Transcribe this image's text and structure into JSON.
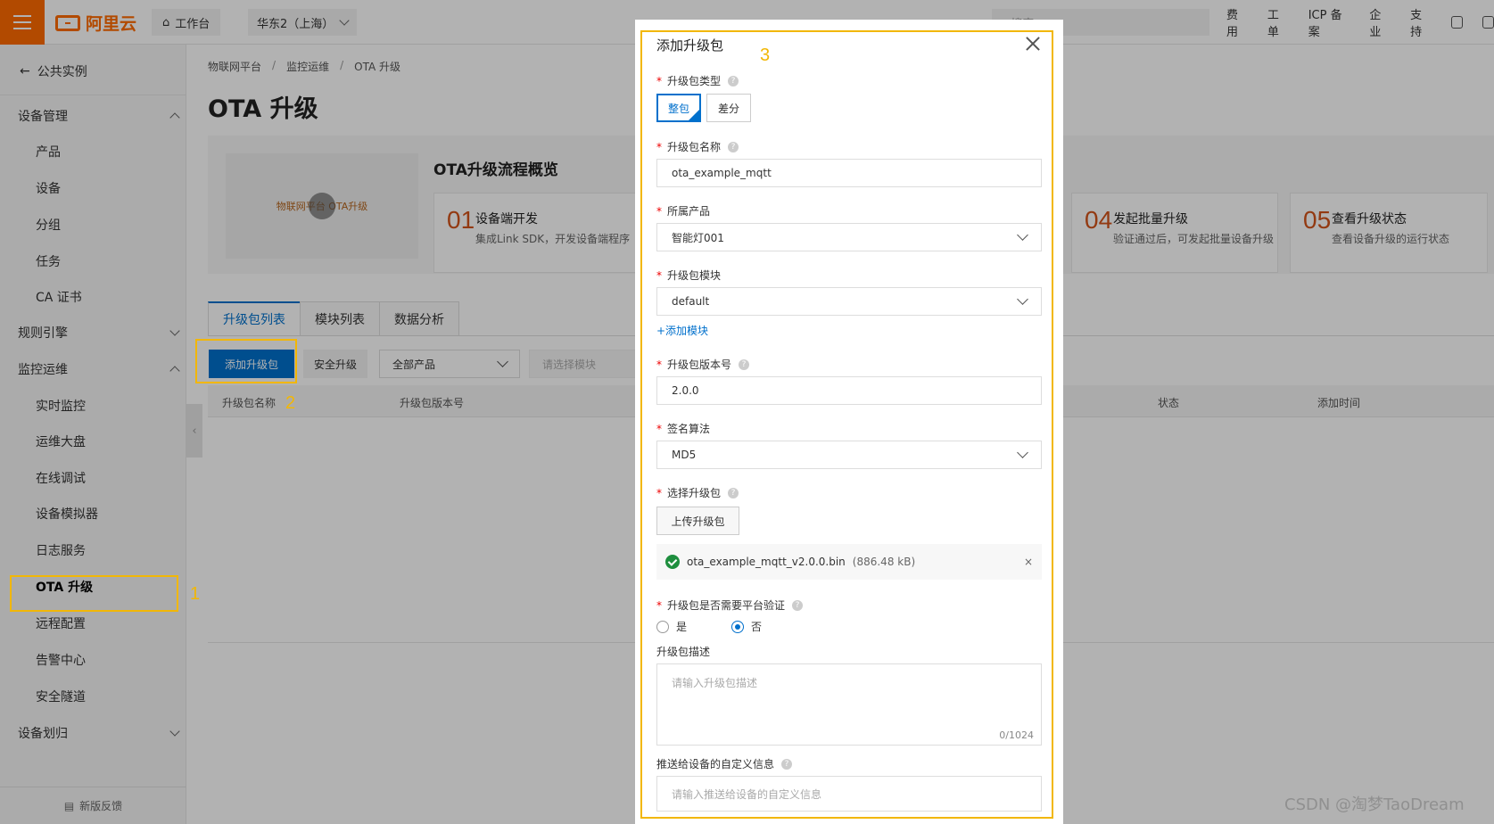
{
  "topbar": {
    "logo_text": "阿里云",
    "workbench": "工作台",
    "region": "华东2（上海）",
    "search_placeholder": "搜索",
    "links": [
      "费用",
      "工单",
      "ICP 备案",
      "企业",
      "支持"
    ]
  },
  "sidebar": {
    "back_label": "公共实例",
    "groups": {
      "device_mgmt": "设备管理",
      "rules": "规则引擎",
      "monitor": "监控运维",
      "assign": "设备划归"
    },
    "items": {
      "product": "产品",
      "device": "设备",
      "group": "分组",
      "task": "任务",
      "ca": "CA 证书",
      "realtime": "实时监控",
      "dashboard": "运维大盘",
      "debug": "在线调试",
      "simulator": "设备模拟器",
      "log": "日志服务",
      "ota": "OTA 升级",
      "remote": "远程配置",
      "alarm": "告警中心",
      "tunnel": "安全隧道"
    },
    "feedback": "新版反馈"
  },
  "main": {
    "breadcrumb": [
      "物联网平台",
      "监控运维",
      "OTA 升级"
    ],
    "title": "OTA 升级",
    "overview": {
      "video_caption": "物联网平台 OTA升级",
      "title": "OTA升级流程概览",
      "steps": [
        {
          "num": "01",
          "title": "设备端开发",
          "desc": "集成Link SDK，开发设备端程序"
        },
        {
          "num": "04",
          "title": "发起批量升级",
          "desc": "验证通过后，可发起批量设备升级"
        },
        {
          "num": "05",
          "title": "查看升级状态",
          "desc": "查看设备升级的运行状态"
        }
      ]
    },
    "tabs": [
      "升级包列表",
      "模块列表",
      "数据分析"
    ],
    "toolbar": {
      "add": "添加升级包",
      "secure": "安全升级",
      "product_filter": "全部产品",
      "module_filter": "请选择模块"
    },
    "table_headers": {
      "name": "升级包名称",
      "version": "升级包版本号",
      "status": "状态",
      "time": "添加时间"
    }
  },
  "dialog": {
    "title": "添加升级包",
    "type_label": "升级包类型",
    "type_full": "整包",
    "type_diff": "差分",
    "name_label": "升级包名称",
    "name_value": "ota_example_mqtt",
    "product_label": "所属产品",
    "product_value": "智能灯001",
    "module_label": "升级包模块",
    "module_value": "default",
    "add_module": "+添加模块",
    "version_label": "升级包版本号",
    "version_value": "2.0.0",
    "sign_label": "签名算法",
    "sign_value": "MD5",
    "pkg_label": "选择升级包",
    "upload_button": "上传升级包",
    "file_name": "ota_example_mqtt_v2.0.0.bin",
    "file_size": "(886.48 kB)",
    "file_remove": "×",
    "verify_label": "升级包是否需要平台验证",
    "verify_yes": "是",
    "verify_no": "否",
    "desc_label": "升级包描述",
    "desc_placeholder": "请输入升级包描述",
    "desc_counter": "0/1024",
    "custom_label": "推送给设备的自定义信息",
    "custom_placeholder": "请输入推送给设备的自定义信息"
  },
  "annotations": {
    "n1": "1",
    "n2": "2",
    "n3": "3"
  },
  "watermark": "CSDN @淘梦TaoDream",
  "colors": {
    "brand": "#ff6a00",
    "primary": "#0070cc",
    "highlight": "#f2b705"
  }
}
